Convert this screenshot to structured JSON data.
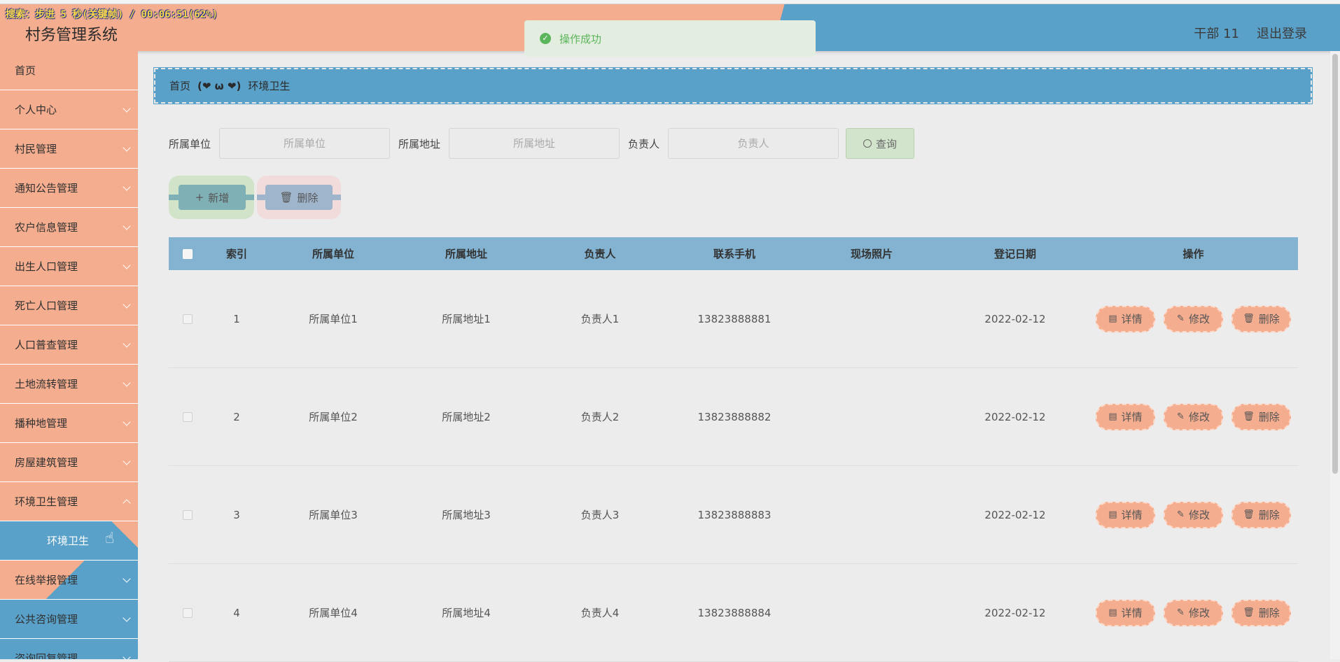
{
  "overlay": {
    "status": "搜索：步进 5 秒(关键帧) / 00:06:51(62%)"
  },
  "header": {
    "title": "村务管理系统",
    "user": "干部 11",
    "logout": "退出登录"
  },
  "toast": {
    "message": "操作成功"
  },
  "sidebar": {
    "items": [
      {
        "label": "首页"
      },
      {
        "label": "个人中心"
      },
      {
        "label": "村民管理"
      },
      {
        "label": "通知公告管理"
      },
      {
        "label": "农户信息管理"
      },
      {
        "label": "出生人口管理"
      },
      {
        "label": "死亡人口管理"
      },
      {
        "label": "人口普查管理"
      },
      {
        "label": "土地流转管理"
      },
      {
        "label": "播种地管理"
      },
      {
        "label": "房屋建筑管理"
      },
      {
        "label": "环境卫生管理"
      },
      {
        "label": "环境卫生"
      },
      {
        "label": "在线举报管理"
      },
      {
        "label": "公共咨询管理"
      },
      {
        "label": "咨询回复管理"
      }
    ]
  },
  "breadcrumb": {
    "home": "首页",
    "separator": "(❤ ω ❤)",
    "current": "环境卫生"
  },
  "search": {
    "unit_label": "所属单位",
    "unit_placeholder": "所属单位",
    "addr_label": "所属地址",
    "addr_placeholder": "所属地址",
    "resp_label": "负责人",
    "resp_placeholder": "负责人",
    "query": "查询"
  },
  "actions": {
    "add": "新增",
    "delete": "删除"
  },
  "table": {
    "headers": [
      "索引",
      "所属单位",
      "所属地址",
      "负责人",
      "联系手机",
      "现场照片",
      "登记日期",
      "操作"
    ],
    "rows": [
      {
        "idx": "1",
        "unit": "所属单位1",
        "addr": "所属地址1",
        "resp": "负责人1",
        "phone": "13823888881",
        "date": "2022-02-12"
      },
      {
        "idx": "2",
        "unit": "所属单位2",
        "addr": "所属地址2",
        "resp": "负责人2",
        "phone": "13823888882",
        "date": "2022-02-12"
      },
      {
        "idx": "3",
        "unit": "所属单位3",
        "addr": "所属地址3",
        "resp": "负责人3",
        "phone": "13823888883",
        "date": "2022-02-12"
      },
      {
        "idx": "4",
        "unit": "所属单位4",
        "addr": "所属地址4",
        "resp": "负责人4",
        "phone": "13823888884",
        "date": "2022-02-12"
      }
    ],
    "ops": {
      "detail": "详情",
      "edit": "修改",
      "delete": "删除"
    }
  },
  "colors": {
    "peach": "#f4ad8f",
    "blue": "#5aa1c9",
    "header_row": "#83b3d1",
    "success": "#5bb55b"
  }
}
